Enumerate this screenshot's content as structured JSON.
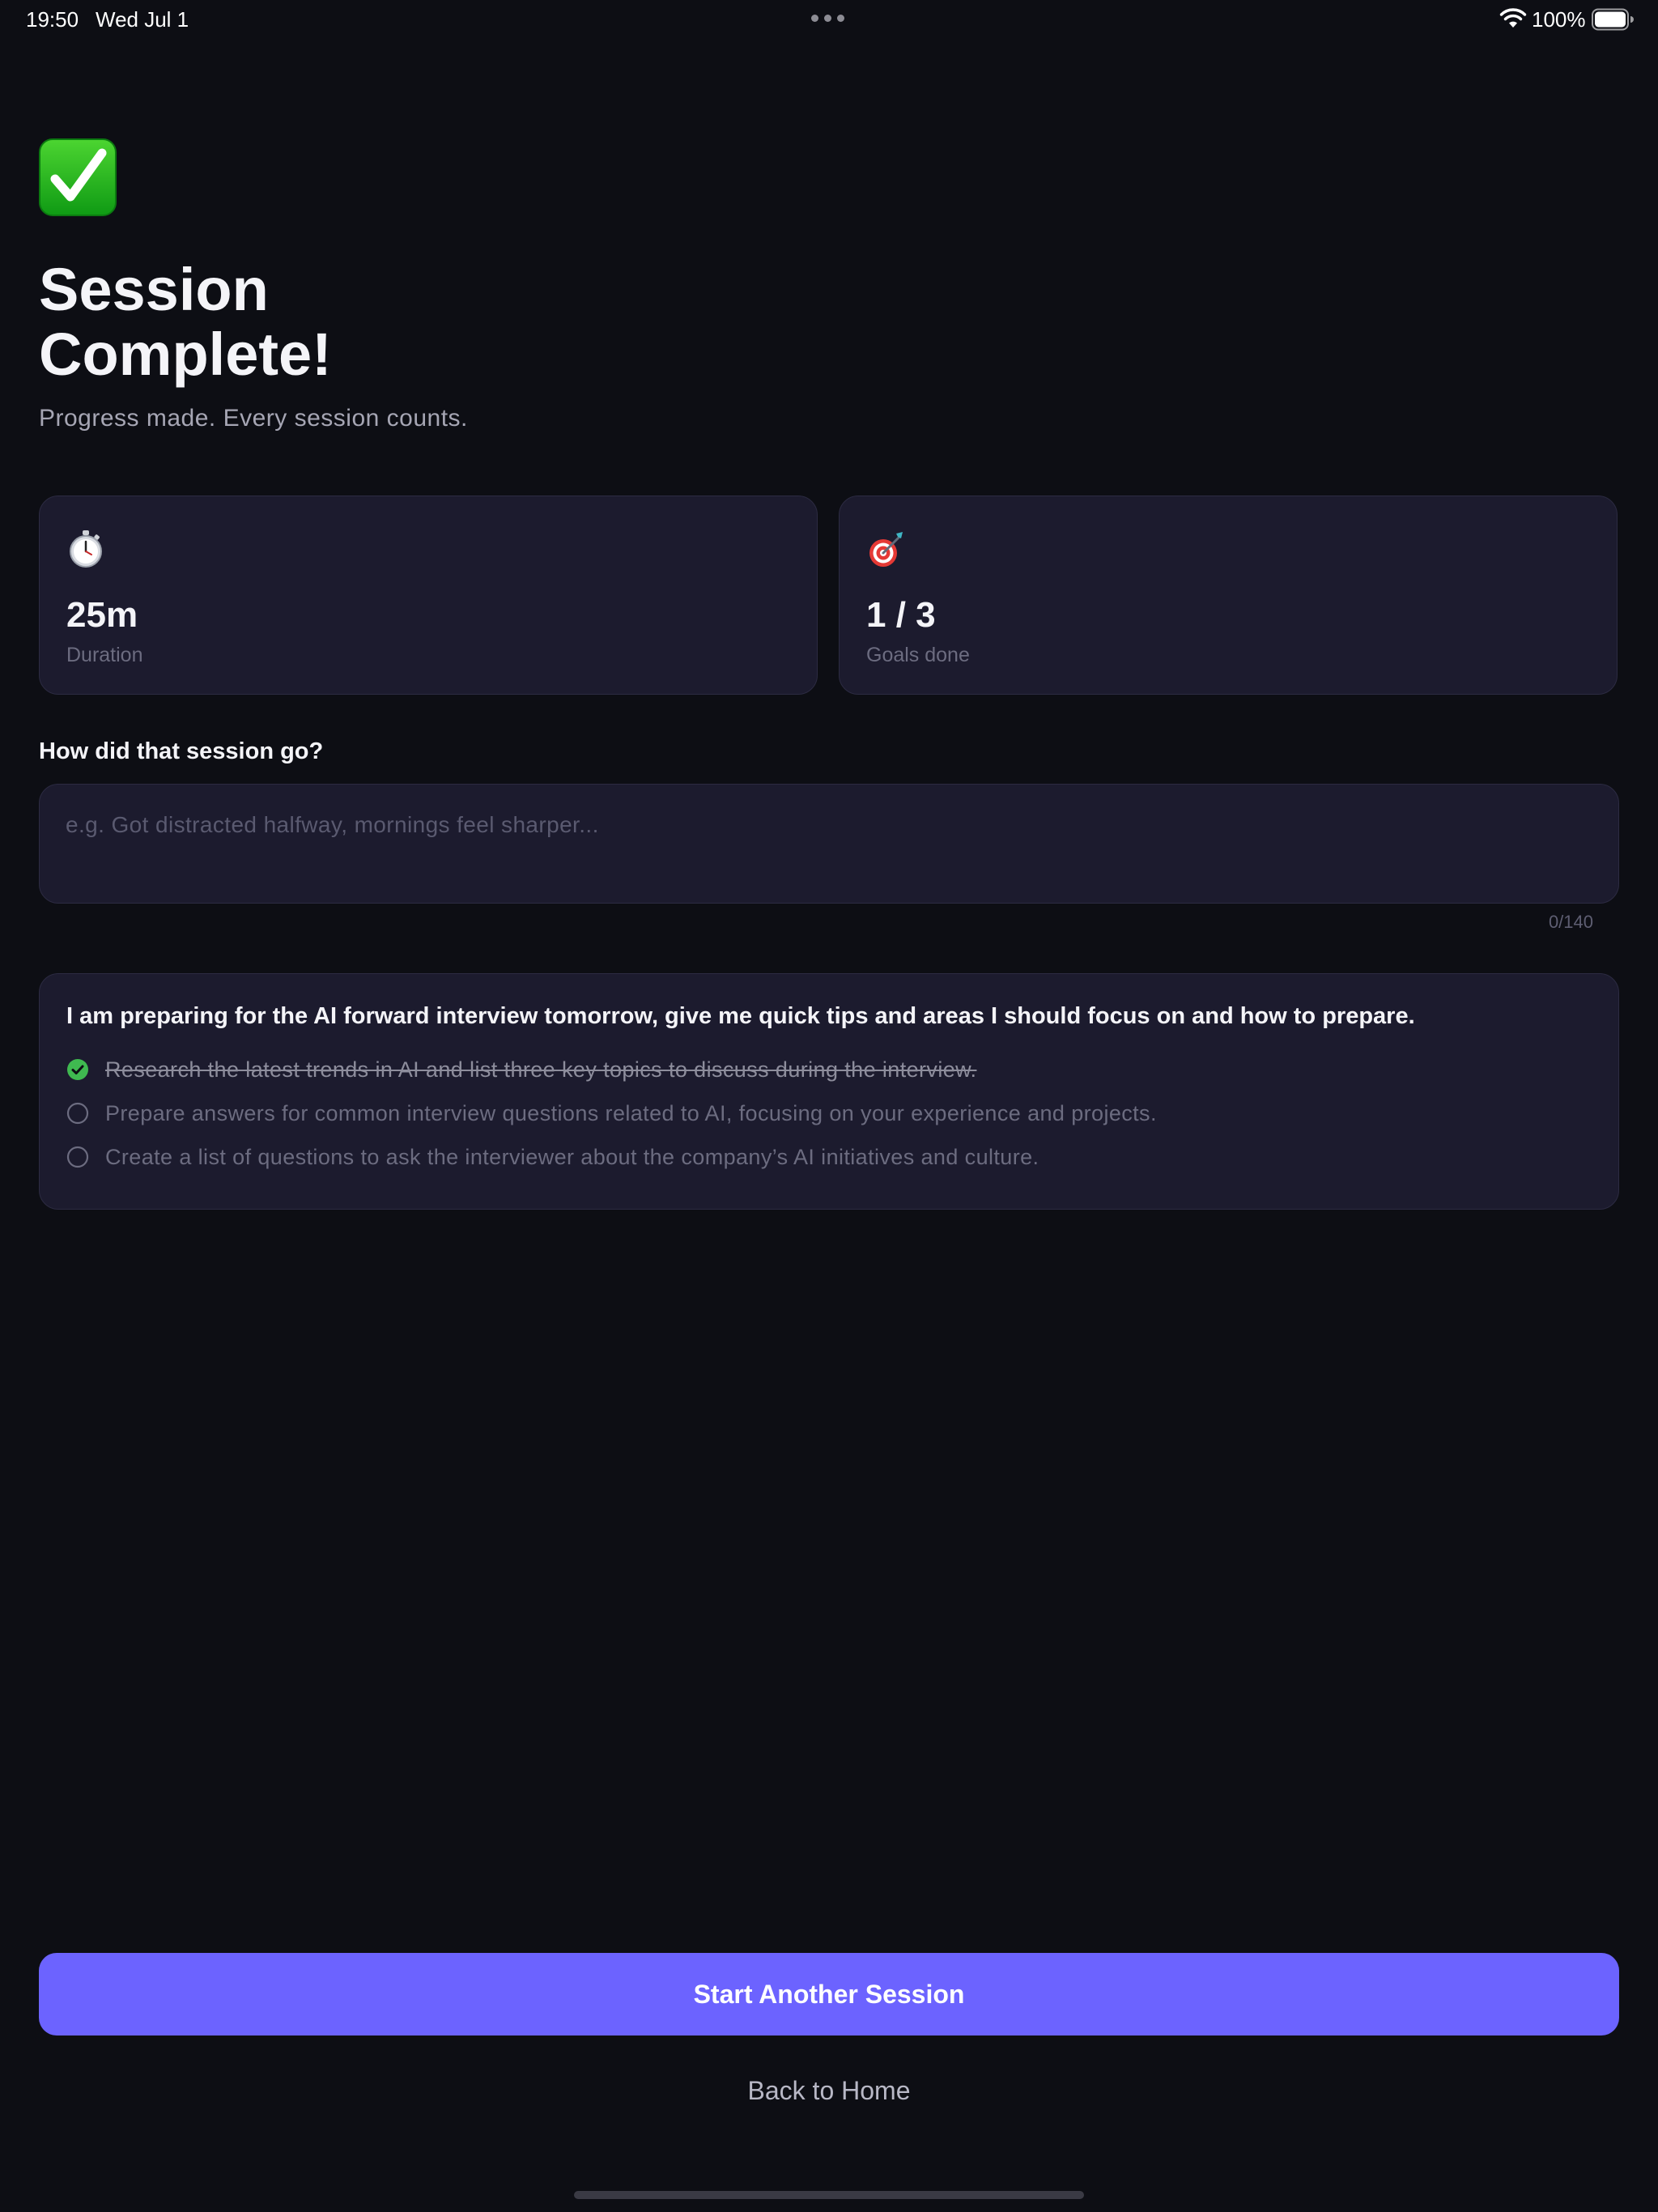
{
  "status_bar": {
    "time": "19:50",
    "date": "Wed Jul 1",
    "battery": "100%",
    "icons": [
      "wifi-icon",
      "battery-icon"
    ]
  },
  "header": {
    "icon": "check-mark-button-icon",
    "title": "Session Complete!",
    "subtitle": "Progress made. Every session counts."
  },
  "stats": [
    {
      "icon": "stopwatch-icon",
      "value": "25m",
      "label": "Duration"
    },
    {
      "icon": "target-icon",
      "value": "1 / 3",
      "label": "Goals done"
    }
  ],
  "goals_progress": 0.333,
  "feedback": {
    "question": "How did that session go?",
    "placeholder": "e.g. Got distracted halfway, mornings feel sharper...",
    "value": "",
    "counter": "0/140"
  },
  "goals": {
    "title": "I am preparing for the AI forward interview tomorrow, give me quick tips and areas I should focus on and how to prepare.",
    "items": [
      {
        "text": "Research the latest trends in AI and list three key topics to discuss during the interview.",
        "done": true
      },
      {
        "text": "Prepare answers for common interview questions related to AI, focusing on your experience and projects.",
        "done": false
      },
      {
        "text": "Create a list of questions to ask the interviewer about the company’s AI initiatives and culture.",
        "done": false
      }
    ]
  },
  "actions": {
    "primary": "Start Another Session",
    "secondary": "Back to Home"
  },
  "colors": {
    "background": "#0d0e14",
    "card": "#1c1b2e",
    "accent": "#6c63ff",
    "success": "#3fb950"
  }
}
